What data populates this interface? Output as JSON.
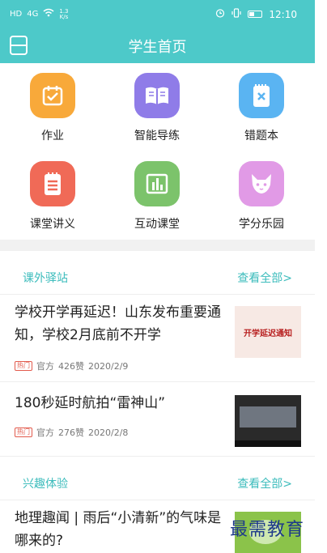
{
  "status_bar": {
    "carrier": "HD",
    "signal": "4G",
    "speed_value": "1.3",
    "speed_unit": "K/s",
    "time": "12:10"
  },
  "navbar": {
    "title": "学生首页"
  },
  "tiles": [
    {
      "label": "作业",
      "icon": "calendar-check-icon",
      "color": "#f8a93a"
    },
    {
      "label": "智能导练",
      "icon": "book-icon",
      "color": "#8f7ce8"
    },
    {
      "label": "错题本",
      "icon": "notebook-x-icon",
      "color": "#5ab4f2"
    },
    {
      "label": "课堂讲义",
      "icon": "notes-icon",
      "color": "#f06a57"
    },
    {
      "label": "互动课堂",
      "icon": "bar-chart-icon",
      "color": "#7cc36b"
    },
    {
      "label": "学分乐园",
      "icon": "fox-icon",
      "color": "#e19ae6"
    }
  ],
  "sections": [
    {
      "title": "课外驿站",
      "more": "查看全部>",
      "articles": [
        {
          "title": "学校开学再延迟！山东发布重要通知，学校2月底前不开学",
          "badge": "热门",
          "source": "官方",
          "likes": "426赞",
          "date": "2020/2/9",
          "thumb_text": "开学延迟通知"
        },
        {
          "title": "180秒延时航拍“雷神山”",
          "badge": "热门",
          "source": "官方",
          "likes": "276赞",
          "date": "2020/2/8"
        }
      ]
    },
    {
      "title": "兴趣体验",
      "more": "查看全部>",
      "articles": [
        {
          "title": "地理趣闻 | 雨后“小清新”的气味是哪来的?"
        }
      ]
    }
  ],
  "watermark": "最需教育",
  "colors": {
    "primary": "#4dc9c9",
    "link": "#3cbcbc",
    "hot": "#e25a4c"
  }
}
